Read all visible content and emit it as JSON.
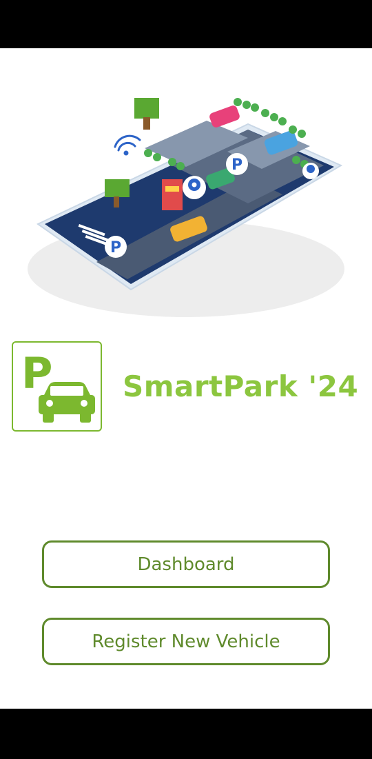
{
  "app": {
    "title": "SmartPark '24",
    "logo_icon": "parking-car-logo",
    "logo_letter": "P"
  },
  "hero": {
    "image": "isometric-smart-parking-illustration",
    "sign_letter": "P"
  },
  "actions": {
    "dashboard_label": "Dashboard",
    "register_label": "Register New Vehicle"
  },
  "colors": {
    "brand_green": "#8cc63f",
    "button_green": "#5f8a2c",
    "logo_green": "#7cb82f"
  }
}
